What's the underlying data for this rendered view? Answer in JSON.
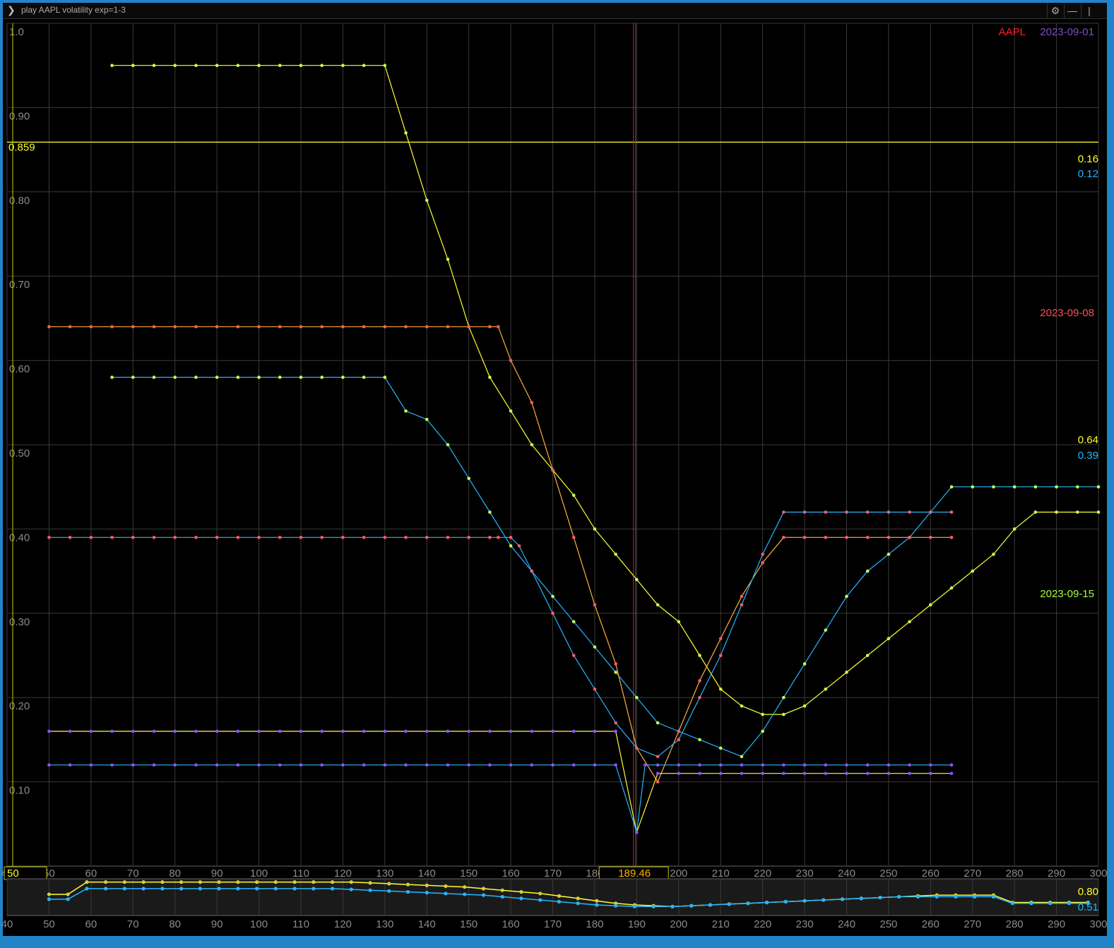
{
  "window": {
    "command_text": "play AAPL volatility exp=1-3",
    "icons": [
      "gear-icon",
      "minimize-icon",
      "maximize-icon"
    ]
  },
  "legend": {
    "symbol": "AAPL",
    "expirations": [
      {
        "label": "2023-09-01",
        "color": "#7a50c8"
      },
      {
        "label": "2023-09-08",
        "color": "#ff4d5a"
      },
      {
        "label": "2023-09-15",
        "color": "#a8ff3a"
      }
    ],
    "value_labels": [
      {
        "text": "0.16",
        "color": "#ffff30"
      },
      {
        "text": "0.12",
        "color": "#25b6ff"
      },
      {
        "text": "0.64",
        "color": "#ffff30"
      },
      {
        "text": "0.39",
        "color": "#25b6ff"
      }
    ]
  },
  "overview": {
    "yellow_label": "0.80",
    "blue_label": "0.51",
    "yellow_values": [
      0.66,
      0.66,
      0.81,
      0.81,
      0.81,
      0.81,
      0.81,
      0.81,
      0.81,
      0.81,
      0.81,
      0.81,
      0.81,
      0.81,
      0.81,
      0.81,
      0.81,
      0.8,
      0.79,
      0.78,
      0.77,
      0.76,
      0.75,
      0.73,
      0.71,
      0.69,
      0.67,
      0.64,
      0.61,
      0.58,
      0.55,
      0.53,
      0.52,
      0.51,
      0.52,
      0.53,
      0.54,
      0.55,
      0.56,
      0.57,
      0.58,
      0.59,
      0.6,
      0.61,
      0.62,
      0.63,
      0.64,
      0.65,
      0.65,
      0.65,
      0.65,
      0.56,
      0.56,
      0.56,
      0.56,
      0.56
    ],
    "blue_values": [
      0.6,
      0.6,
      0.73,
      0.73,
      0.73,
      0.73,
      0.73,
      0.73,
      0.73,
      0.73,
      0.73,
      0.73,
      0.73,
      0.73,
      0.73,
      0.73,
      0.72,
      0.71,
      0.7,
      0.69,
      0.68,
      0.67,
      0.66,
      0.65,
      0.63,
      0.61,
      0.59,
      0.57,
      0.55,
      0.53,
      0.52,
      0.51,
      0.51,
      0.51,
      0.52,
      0.53,
      0.54,
      0.55,
      0.56,
      0.57,
      0.58,
      0.59,
      0.6,
      0.61,
      0.62,
      0.63,
      0.63,
      0.63,
      0.63,
      0.63,
      0.63,
      0.55,
      0.55,
      0.55,
      0.55,
      0.55
    ]
  },
  "chart_data": {
    "type": "line",
    "title": "",
    "xlabel": "",
    "ylabel": "",
    "xlim": [
      40,
      300
    ],
    "ylim": [
      0.0,
      1.0
    ],
    "x_ticks": [
      40,
      50,
      60,
      70,
      80,
      90,
      100,
      110,
      120,
      130,
      140,
      150,
      160,
      170,
      180,
      190,
      200,
      210,
      220,
      230,
      240,
      250,
      260,
      270,
      280,
      290,
      300
    ],
    "x_tick_labels": [
      "40",
      "50",
      "60",
      "70",
      "80",
      "90",
      "100",
      "110",
      "120",
      "130",
      "140",
      "150",
      "160",
      "170",
      "180",
      "190",
      "200",
      "210",
      "220",
      "230",
      "240",
      "250",
      "260",
      "270",
      "280",
      "290",
      "300"
    ],
    "y_ticks": [
      0.1,
      0.2,
      0.3,
      0.4,
      0.5,
      0.6,
      0.7,
      0.8,
      0.9,
      1.0
    ],
    "y_tick_labels": [
      "0.10",
      "0.20",
      "0.30",
      "0.40",
      "0.50",
      "0.60",
      "0.70",
      "0.80",
      "0.90",
      "1.0"
    ],
    "grid": true,
    "hline": {
      "value": 0.859,
      "label": "0.859",
      "color": "#ffff30"
    },
    "vline": {
      "value": 189.46,
      "label": "189.46",
      "color": "#d02020"
    },
    "left_box_label": "50",
    "series": [
      {
        "color": "#ffff30",
        "dot": "#c8ff50",
        "x": [
          65,
          70,
          75,
          80,
          85,
          90,
          95,
          100,
          105,
          110,
          115,
          120,
          125,
          130,
          135,
          140,
          145,
          150,
          155,
          160,
          165,
          170,
          175,
          180,
          185,
          190,
          195,
          200,
          205,
          210,
          215,
          220,
          225,
          230,
          235,
          240,
          245,
          250,
          255,
          260,
          265,
          270,
          275,
          280,
          285,
          290,
          295,
          300
        ],
        "values": [
          0.95,
          0.95,
          0.95,
          0.95,
          0.95,
          0.95,
          0.95,
          0.95,
          0.95,
          0.95,
          0.95,
          0.95,
          0.95,
          0.95,
          0.87,
          0.79,
          0.72,
          0.64,
          0.58,
          0.54,
          0.5,
          0.47,
          0.44,
          0.4,
          0.37,
          0.34,
          0.31,
          0.29,
          0.25,
          0.21,
          0.19,
          0.18,
          0.18,
          0.19,
          0.21,
          0.23,
          0.25,
          0.27,
          0.29,
          0.31,
          0.33,
          0.35,
          0.37,
          0.4,
          0.42,
          0.42,
          0.42,
          0.42
        ]
      },
      {
        "color": "#25b6ff",
        "dot": "#c8ff50",
        "x": [
          65,
          70,
          75,
          80,
          85,
          90,
          95,
          100,
          105,
          110,
          115,
          120,
          125,
          130,
          135,
          140,
          145,
          150,
          155,
          160,
          165,
          170,
          175,
          180,
          185,
          190,
          195,
          200,
          205,
          210,
          215,
          220,
          225,
          230,
          235,
          240,
          245,
          250,
          255,
          260,
          265,
          270,
          275,
          280,
          285,
          290,
          295,
          300
        ],
        "values": [
          0.58,
          0.58,
          0.58,
          0.58,
          0.58,
          0.58,
          0.58,
          0.58,
          0.58,
          0.58,
          0.58,
          0.58,
          0.58,
          0.58,
          0.54,
          0.53,
          0.5,
          0.46,
          0.42,
          0.38,
          0.35,
          0.32,
          0.29,
          0.26,
          0.23,
          0.2,
          0.17,
          0.16,
          0.15,
          0.14,
          0.13,
          0.16,
          0.2,
          0.24,
          0.28,
          0.32,
          0.35,
          0.37,
          0.39,
          0.42,
          0.45,
          0.45,
          0.45,
          0.45,
          0.45,
          0.45,
          0.45,
          0.45
        ]
      },
      {
        "color": "#ffb040",
        "dot": "#ff5a6a",
        "x": [
          50,
          55,
          60,
          65,
          70,
          75,
          80,
          85,
          90,
          95,
          100,
          105,
          110,
          115,
          120,
          125,
          130,
          135,
          140,
          145,
          150,
          155,
          157,
          160,
          165,
          170,
          175,
          180,
          185,
          190,
          195,
          200,
          205,
          210,
          215,
          220,
          225,
          230,
          235,
          240,
          245,
          250,
          255,
          260,
          265
        ],
        "values": [
          0.64,
          0.64,
          0.64,
          0.64,
          0.64,
          0.64,
          0.64,
          0.64,
          0.64,
          0.64,
          0.64,
          0.64,
          0.64,
          0.64,
          0.64,
          0.64,
          0.64,
          0.64,
          0.64,
          0.64,
          0.64,
          0.64,
          0.64,
          0.6,
          0.55,
          0.47,
          0.39,
          0.31,
          0.24,
          0.14,
          0.1,
          0.16,
          0.22,
          0.27,
          0.32,
          0.36,
          0.39,
          0.39,
          0.39,
          0.39,
          0.39,
          0.39,
          0.39,
          0.39,
          0.39
        ]
      },
      {
        "color": "#25b6ff",
        "dot": "#ff5a6a",
        "x": [
          50,
          55,
          60,
          65,
          70,
          75,
          80,
          85,
          90,
          95,
          100,
          105,
          110,
          115,
          120,
          125,
          130,
          135,
          140,
          145,
          150,
          155,
          157,
          160,
          162,
          165,
          170,
          175,
          180,
          185,
          190,
          195,
          200,
          205,
          210,
          215,
          220,
          225,
          230,
          235,
          240,
          245,
          250,
          255,
          260,
          265
        ],
        "values": [
          0.39,
          0.39,
          0.39,
          0.39,
          0.39,
          0.39,
          0.39,
          0.39,
          0.39,
          0.39,
          0.39,
          0.39,
          0.39,
          0.39,
          0.39,
          0.39,
          0.39,
          0.39,
          0.39,
          0.39,
          0.39,
          0.39,
          0.39,
          0.39,
          0.38,
          0.35,
          0.3,
          0.25,
          0.21,
          0.17,
          0.14,
          0.13,
          0.15,
          0.2,
          0.25,
          0.31,
          0.37,
          0.42,
          0.42,
          0.42,
          0.42,
          0.42,
          0.42,
          0.42,
          0.42,
          0.42
        ]
      },
      {
        "color": "#ffff30",
        "dot": "#9050ff",
        "x": [
          50,
          55,
          60,
          65,
          70,
          75,
          80,
          85,
          90,
          95,
          100,
          105,
          110,
          115,
          120,
          125,
          130,
          135,
          140,
          145,
          150,
          155,
          160,
          165,
          170,
          175,
          180,
          185,
          190,
          195,
          200,
          205,
          210,
          215,
          220,
          225,
          230,
          235,
          240,
          245,
          250,
          255,
          260,
          265
        ],
        "values": [
          0.16,
          0.16,
          0.16,
          0.16,
          0.16,
          0.16,
          0.16,
          0.16,
          0.16,
          0.16,
          0.16,
          0.16,
          0.16,
          0.16,
          0.16,
          0.16,
          0.16,
          0.16,
          0.16,
          0.16,
          0.16,
          0.16,
          0.16,
          0.16,
          0.16,
          0.16,
          0.16,
          0.16,
          0.04,
          0.11,
          0.11,
          0.11,
          0.11,
          0.11,
          0.11,
          0.11,
          0.11,
          0.11,
          0.11,
          0.11,
          0.11,
          0.11,
          0.11,
          0.11
        ]
      },
      {
        "color": "#25b6ff",
        "dot": "#9050ff",
        "x": [
          50,
          55,
          60,
          65,
          70,
          75,
          80,
          85,
          90,
          95,
          100,
          105,
          110,
          115,
          120,
          125,
          130,
          135,
          140,
          145,
          150,
          155,
          160,
          165,
          170,
          175,
          180,
          185,
          190,
          192,
          195,
          200,
          205,
          210,
          215,
          220,
          225,
          230,
          235,
          240,
          245,
          250,
          255,
          260,
          265
        ],
        "values": [
          0.12,
          0.12,
          0.12,
          0.12,
          0.12,
          0.12,
          0.12,
          0.12,
          0.12,
          0.12,
          0.12,
          0.12,
          0.12,
          0.12,
          0.12,
          0.12,
          0.12,
          0.12,
          0.12,
          0.12,
          0.12,
          0.12,
          0.12,
          0.12,
          0.12,
          0.12,
          0.12,
          0.12,
          0.04,
          0.12,
          0.12,
          0.12,
          0.12,
          0.12,
          0.12,
          0.12,
          0.12,
          0.12,
          0.12,
          0.12,
          0.12,
          0.12,
          0.12,
          0.12,
          0.12
        ]
      }
    ]
  }
}
